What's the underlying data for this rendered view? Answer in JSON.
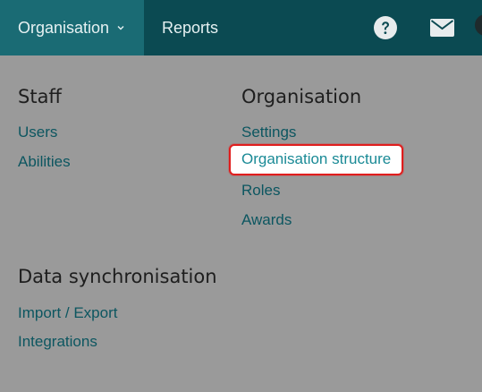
{
  "topbar": {
    "nav": [
      {
        "label": "Organisation"
      },
      {
        "label": "Reports"
      }
    ],
    "icons": [
      "help-icon",
      "mail-icon"
    ],
    "colors": {
      "bar": "#0b4a52",
      "active": "#1a6b74"
    }
  },
  "menu": {
    "staff": {
      "heading": "Staff",
      "items": [
        "Users",
        "Abilities"
      ]
    },
    "organisation": {
      "heading": "Organisation",
      "items": [
        "Settings",
        "Organisation structure",
        "Roles",
        "Awards"
      ],
      "highlighted": "Organisation structure"
    },
    "data_sync": {
      "heading": "Data synchronisation",
      "items": [
        "Import / Export",
        "Integrations"
      ]
    }
  }
}
